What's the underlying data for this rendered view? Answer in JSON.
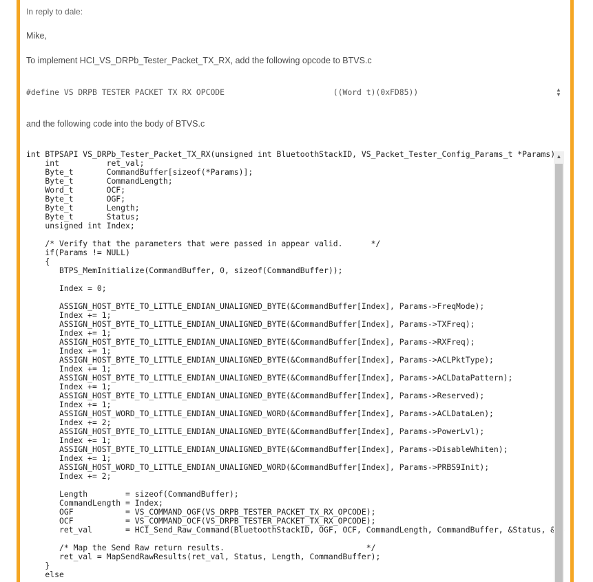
{
  "post": {
    "reply_to": "In reply to dale:",
    "greeting": "Mike,",
    "intro": "To implement HCI_VS_DRPb_Tester_Packet_TX_RX, add the following opcode to BTVS.c",
    "define_line": "#define VS DRPB TESTER PACKET TX RX OPCODE                       ((Word t)(0xFD85))",
    "following_text": "and the following code into the body of BTVS.c"
  },
  "code": {
    "signature": "int BTPSAPI VS_DRPb_Tester_Packet_TX_RX(unsigned int BluetoothStackID, VS_Packet_Tester_Config_Params_t *Params)",
    "l01": "    int          ret_val;",
    "l02": "    Byte_t       CommandBuffer[sizeof(*Params)];",
    "l03": "    Byte_t       CommandLength;",
    "l04": "    Word_t       OCF;",
    "l05": "    Byte_t       OGF;",
    "l06": "    Byte_t       Length;",
    "l07": "    Byte_t       Status;",
    "l08": "    unsigned int Index;",
    "l09": "",
    "l10": "    /* Verify that the parameters that were passed in appear valid.      */",
    "l11": "    if(Params != NULL)",
    "l12": "    {",
    "l13": "       BTPS_MemInitialize(CommandBuffer, 0, sizeof(CommandBuffer));",
    "l14": "",
    "l15": "       Index = 0;",
    "l16": "",
    "l17": "       ASSIGN_HOST_BYTE_TO_LITTLE_ENDIAN_UNALIGNED_BYTE(&CommandBuffer[Index], Params->FreqMode);",
    "l18": "       Index += 1;",
    "l19": "       ASSIGN_HOST_BYTE_TO_LITTLE_ENDIAN_UNALIGNED_BYTE(&CommandBuffer[Index], Params->TXFreq);",
    "l20": "       Index += 1;",
    "l21": "       ASSIGN_HOST_BYTE_TO_LITTLE_ENDIAN_UNALIGNED_BYTE(&CommandBuffer[Index], Params->RXFreq);",
    "l22": "       Index += 1;",
    "l23": "       ASSIGN_HOST_BYTE_TO_LITTLE_ENDIAN_UNALIGNED_BYTE(&CommandBuffer[Index], Params->ACLPktType);",
    "l24": "       Index += 1;",
    "l25": "       ASSIGN_HOST_BYTE_TO_LITTLE_ENDIAN_UNALIGNED_BYTE(&CommandBuffer[Index], Params->ACLDataPattern);",
    "l26": "       Index += 1;",
    "l27": "       ASSIGN_HOST_BYTE_TO_LITTLE_ENDIAN_UNALIGNED_BYTE(&CommandBuffer[Index], Params->Reserved);",
    "l28": "       Index += 1;",
    "l29": "       ASSIGN_HOST_WORD_TO_LITTLE_ENDIAN_UNALIGNED_WORD(&CommandBuffer[Index], Params->ACLDataLen);",
    "l30": "       Index += 2;",
    "l31": "       ASSIGN_HOST_BYTE_TO_LITTLE_ENDIAN_UNALIGNED_BYTE(&CommandBuffer[Index], Params->PowerLvl);",
    "l32": "       Index += 1;",
    "l33": "       ASSIGN_HOST_BYTE_TO_LITTLE_ENDIAN_UNALIGNED_BYTE(&CommandBuffer[Index], Params->DisableWhiten);",
    "l34": "       Index += 1;",
    "l35": "       ASSIGN_HOST_WORD_TO_LITTLE_ENDIAN_UNALIGNED_WORD(&CommandBuffer[Index], Params->PRBS9Init);",
    "l36": "       Index += 2;",
    "l37": "",
    "l38": "       Length        = sizeof(CommandBuffer);",
    "l39": "       CommandLength = Index;",
    "l40": "       OGF           = VS_COMMAND_OGF(VS_DRPB_TESTER_PACKET_TX_RX_OPCODE);",
    "l41": "       OCF           = VS_COMMAND_OCF(VS_DRPB_TESTER_PACKET_TX_RX_OPCODE);",
    "l42": "       ret_val       = HCI_Send_Raw_Command(BluetoothStackID, OGF, OCF, CommandLength, CommandBuffer, &Status, &Length, CommandBuffer, TRUE);",
    "l43": "",
    "l44": "       /* Map the Send Raw return results.                              */",
    "l45": "       ret_val = MapSendRawResults(ret_val, Status, Length, CommandBuffer);",
    "l46": "    }",
    "l47": "    else"
  },
  "colors": {
    "frame": "#f5a623",
    "comment": "#2e7d32",
    "keyword": "#2255aa"
  }
}
